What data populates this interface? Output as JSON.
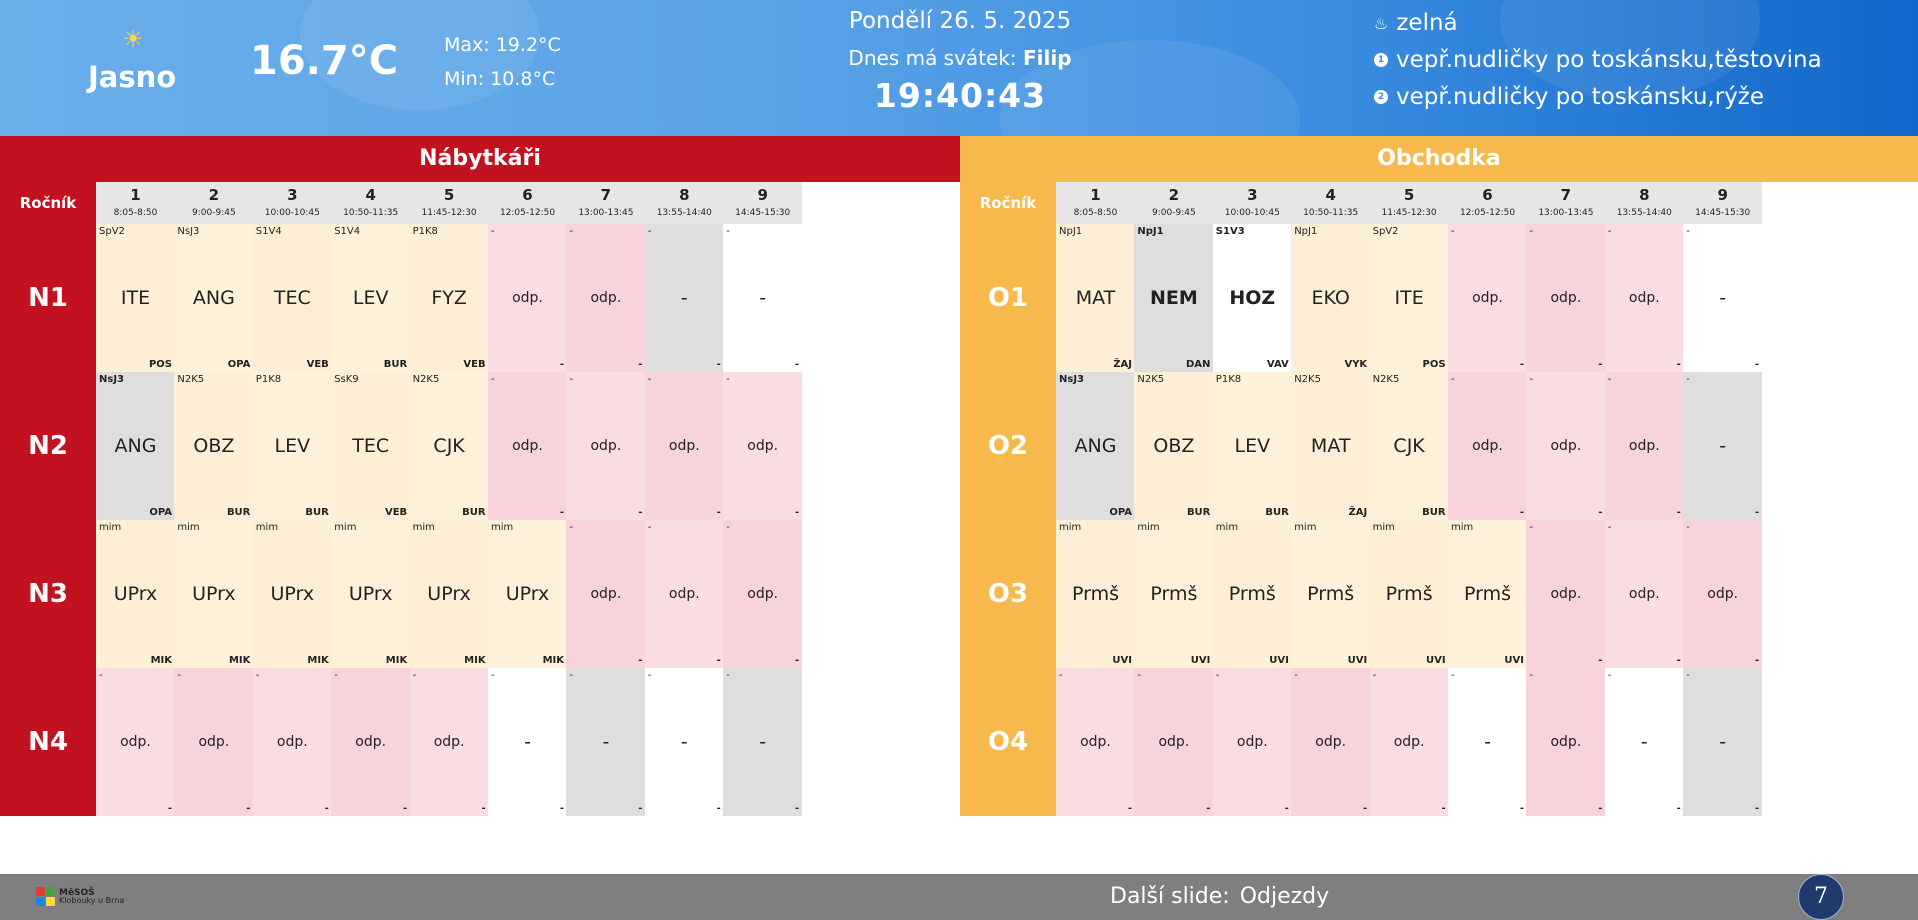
{
  "header": {
    "weather_icon": "sun-icon",
    "condition": "Jasno",
    "temperature": "16.7°C",
    "max": "Max: 19.2°C",
    "min": "Min: 10.8°C",
    "date": "Pondělí 26. 5. 2025",
    "nameday_prefix": "Dnes má svátek:",
    "nameday_name": "Filip",
    "time": "19:40:43",
    "menu": [
      {
        "icon": "soup-icon",
        "text": "zelná"
      },
      {
        "icon": "number-one-icon",
        "text": "vepř.nudličky po toskánsku,těstovina"
      },
      {
        "icon": "number-two-icon",
        "text": "vepř.nudličky po toskánsku,rýže"
      }
    ]
  },
  "periods": [
    {
      "num": "1",
      "time": "8:05-8:50"
    },
    {
      "num": "2",
      "time": "9:00-9:45"
    },
    {
      "num": "3",
      "time": "10:00-10:45"
    },
    {
      "num": "4",
      "time": "10:50-11:35"
    },
    {
      "num": "5",
      "time": "11:45-12:30"
    },
    {
      "num": "6",
      "time": "12:05-12:50"
    },
    {
      "num": "7",
      "time": "13:00-13:45"
    },
    {
      "num": "8",
      "time": "13:55-14:40"
    },
    {
      "num": "9",
      "time": "14:45-15:30"
    }
  ],
  "rocnik_label": "Ročník",
  "tables": [
    {
      "title": "Nábytkáři",
      "rows": [
        {
          "label": "N1",
          "cells": [
            {
              "room": "SpV2",
              "subj": "ITE",
              "teach": "POS",
              "bg": "bg-lesson"
            },
            {
              "room": "NsJ3",
              "subj": "ANG",
              "teach": "OPA",
              "bg": "bg-lesson2"
            },
            {
              "room": "S1V4",
              "subj": "TEC",
              "teach": "VEB",
              "bg": "bg-lesson"
            },
            {
              "room": "S1V4",
              "subj": "LEV",
              "teach": "BUR",
              "bg": "bg-lesson2"
            },
            {
              "room": "P1K8",
              "subj": "FYZ",
              "teach": "VEB",
              "bg": "bg-lesson"
            },
            {
              "room": "-",
              "subj": "odp.",
              "teach": "-",
              "bg": "bg-pink",
              "small": true
            },
            {
              "room": "-",
              "subj": "odp.",
              "teach": "-",
              "bg": "bg-pink2",
              "small": true
            },
            {
              "room": "-",
              "subj": "-",
              "teach": "-",
              "bg": "bg-grey"
            },
            {
              "room": "-",
              "subj": "-",
              "teach": "-",
              "bg": "bg-white"
            }
          ]
        },
        {
          "label": "N2",
          "cells": [
            {
              "room": "NsJ3",
              "subj": "ANG",
              "teach": "OPA",
              "bg": "bg-grey",
              "strong": true
            },
            {
              "room": "N2K5",
              "subj": "OBZ",
              "teach": "BUR",
              "bg": "bg-lesson"
            },
            {
              "room": "P1K8",
              "subj": "LEV",
              "teach": "BUR",
              "bg": "bg-lesson2"
            },
            {
              "room": "SsK9",
              "subj": "TEC",
              "teach": "VEB",
              "bg": "bg-lesson"
            },
            {
              "room": "N2K5",
              "subj": "CJK",
              "teach": "BUR",
              "bg": "bg-lesson2"
            },
            {
              "room": "-",
              "subj": "odp.",
              "teach": "-",
              "bg": "bg-pink2",
              "small": true
            },
            {
              "room": "-",
              "subj": "odp.",
              "teach": "-",
              "bg": "bg-pink",
              "small": true
            },
            {
              "room": "-",
              "subj": "odp.",
              "teach": "-",
              "bg": "bg-pink2",
              "small": true
            },
            {
              "room": "-",
              "subj": "odp.",
              "teach": "-",
              "bg": "bg-pink",
              "small": true
            }
          ]
        },
        {
          "label": "N3",
          "cells": [
            {
              "room": "mim",
              "subj": "UPrx",
              "teach": "MIK",
              "bg": "bg-lesson"
            },
            {
              "room": "mim",
              "subj": "UPrx",
              "teach": "MIK",
              "bg": "bg-lesson2"
            },
            {
              "room": "mim",
              "subj": "UPrx",
              "teach": "MIK",
              "bg": "bg-lesson"
            },
            {
              "room": "mim",
              "subj": "UPrx",
              "teach": "MIK",
              "bg": "bg-lesson2"
            },
            {
              "room": "mim",
              "subj": "UPrx",
              "teach": "MIK",
              "bg": "bg-lesson"
            },
            {
              "room": "mim",
              "subj": "UPrx",
              "teach": "MIK",
              "bg": "bg-lesson2"
            },
            {
              "room": "-",
              "subj": "odp.",
              "teach": "-",
              "bg": "bg-pink2",
              "small": true
            },
            {
              "room": "-",
              "subj": "odp.",
              "teach": "-",
              "bg": "bg-pink",
              "small": true
            },
            {
              "room": "-",
              "subj": "odp.",
              "teach": "-",
              "bg": "bg-pink2",
              "small": true
            }
          ]
        },
        {
          "label": "N4",
          "cells": [
            {
              "room": "-",
              "subj": "odp.",
              "teach": "-",
              "bg": "bg-pink",
              "small": true
            },
            {
              "room": "-",
              "subj": "odp.",
              "teach": "-",
              "bg": "bg-pink2",
              "small": true
            },
            {
              "room": "-",
              "subj": "odp.",
              "teach": "-",
              "bg": "bg-pink",
              "small": true
            },
            {
              "room": "-",
              "subj": "odp.",
              "teach": "-",
              "bg": "bg-pink2",
              "small": true
            },
            {
              "room": "-",
              "subj": "odp.",
              "teach": "-",
              "bg": "bg-pink",
              "small": true
            },
            {
              "room": "-",
              "subj": "-",
              "teach": "-",
              "bg": "bg-white"
            },
            {
              "room": "-",
              "subj": "-",
              "teach": "-",
              "bg": "bg-grey"
            },
            {
              "room": "-",
              "subj": "-",
              "teach": "-",
              "bg": "bg-white"
            },
            {
              "room": "-",
              "subj": "-",
              "teach": "-",
              "bg": "bg-grey"
            }
          ]
        }
      ]
    },
    {
      "title": "Obchodka",
      "rows": [
        {
          "label": "O1",
          "cells": [
            {
              "room": "NpJ1",
              "subj": "MAT",
              "teach": "ŽAJ",
              "bg": "bg-lesson"
            },
            {
              "room": "NpJ1",
              "subj": "NEM",
              "teach": "DAN",
              "bg": "bg-grey",
              "strong": true,
              "bold": true
            },
            {
              "room": "S1V3",
              "subj": "HOZ",
              "teach": "VAV",
              "bg": "bg-white",
              "strong": true,
              "bold": true
            },
            {
              "room": "NpJ1",
              "subj": "EKO",
              "teach": "VYK",
              "bg": "bg-lesson"
            },
            {
              "room": "SpV2",
              "subj": "ITE",
              "teach": "POS",
              "bg": "bg-lesson2"
            },
            {
              "room": "-",
              "subj": "odp.",
              "teach": "-",
              "bg": "bg-pink",
              "small": true
            },
            {
              "room": "-",
              "subj": "odp.",
              "teach": "-",
              "bg": "bg-pink2",
              "small": true
            },
            {
              "room": "-",
              "subj": "odp.",
              "teach": "-",
              "bg": "bg-pink",
              "small": true
            },
            {
              "room": "-",
              "subj": "-",
              "teach": "-",
              "bg": "bg-white"
            }
          ]
        },
        {
          "label": "O2",
          "cells": [
            {
              "room": "NsJ3",
              "subj": "ANG",
              "teach": "OPA",
              "bg": "bg-grey",
              "strong": true
            },
            {
              "room": "N2K5",
              "subj": "OBZ",
              "teach": "BUR",
              "bg": "bg-lesson"
            },
            {
              "room": "P1K8",
              "subj": "LEV",
              "teach": "BUR",
              "bg": "bg-lesson2"
            },
            {
              "room": "N2K5",
              "subj": "MAT",
              "teach": "ŽAJ",
              "bg": "bg-lesson"
            },
            {
              "room": "N2K5",
              "subj": "CJK",
              "teach": "BUR",
              "bg": "bg-lesson2"
            },
            {
              "room": "-",
              "subj": "odp.",
              "teach": "-",
              "bg": "bg-pink2",
              "small": true
            },
            {
              "room": "-",
              "subj": "odp.",
              "teach": "-",
              "bg": "bg-pink",
              "small": true
            },
            {
              "room": "-",
              "subj": "odp.",
              "teach": "-",
              "bg": "bg-pink2",
              "small": true
            },
            {
              "room": "-",
              "subj": "-",
              "teach": "-",
              "bg": "bg-grey"
            }
          ]
        },
        {
          "label": "O3",
          "cells": [
            {
              "room": "mim",
              "subj": "Prmš",
              "teach": "UVI",
              "bg": "bg-lesson"
            },
            {
              "room": "mim",
              "subj": "Prmš",
              "teach": "UVI",
              "bg": "bg-lesson2"
            },
            {
              "room": "mim",
              "subj": "Prmš",
              "teach": "UVI",
              "bg": "bg-lesson"
            },
            {
              "room": "mim",
              "subj": "Prmš",
              "teach": "UVI",
              "bg": "bg-lesson2"
            },
            {
              "room": "mim",
              "subj": "Prmš",
              "teach": "UVI",
              "bg": "bg-lesson"
            },
            {
              "room": "mim",
              "subj": "Prmš",
              "teach": "UVI",
              "bg": "bg-lesson2"
            },
            {
              "room": "-",
              "subj": "odp.",
              "teach": "-",
              "bg": "bg-pink2",
              "small": true
            },
            {
              "room": "-",
              "subj": "odp.",
              "teach": "-",
              "bg": "bg-pink",
              "small": true
            },
            {
              "room": "-",
              "subj": "odp.",
              "teach": "-",
              "bg": "bg-pink2",
              "small": true
            }
          ]
        },
        {
          "label": "O4",
          "cells": [
            {
              "room": "-",
              "subj": "odp.",
              "teach": "-",
              "bg": "bg-pink",
              "small": true
            },
            {
              "room": "-",
              "subj": "odp.",
              "teach": "-",
              "bg": "bg-pink2",
              "small": true
            },
            {
              "room": "-",
              "subj": "odp.",
              "teach": "-",
              "bg": "bg-pink",
              "small": true
            },
            {
              "room": "-",
              "subj": "odp.",
              "teach": "-",
              "bg": "bg-pink2",
              "small": true
            },
            {
              "room": "-",
              "subj": "odp.",
              "teach": "-",
              "bg": "bg-pink",
              "small": true
            },
            {
              "room": "-",
              "subj": "-",
              "teach": "-",
              "bg": "bg-white"
            },
            {
              "room": "-",
              "subj": "odp.",
              "teach": "-",
              "bg": "bg-pink2",
              "small": true
            },
            {
              "room": "-",
              "subj": "-",
              "teach": "-",
              "bg": "bg-white"
            },
            {
              "room": "-",
              "subj": "-",
              "teach": "-",
              "bg": "bg-grey"
            }
          ]
        }
      ]
    }
  ],
  "footer": {
    "logo_name": "MěSOŠ",
    "logo_sub": "Klobouky u Brna",
    "next_label": "Další slide:",
    "next_value": "Odjezdy",
    "slide_number": "7"
  },
  "colors": {
    "left_accent": "#c2121f",
    "right_accent": "#f8b94c",
    "header_gradient_end": "#1167c9",
    "footer_bg": "#7f7f7f"
  }
}
